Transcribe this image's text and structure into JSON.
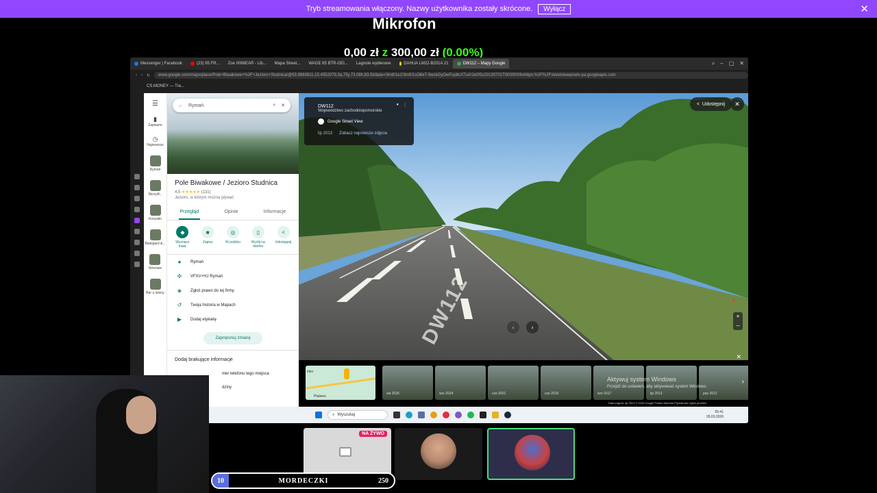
{
  "stream_banner": {
    "text": "Tryb streamowania włączony. Nazwy użytkownika zostały skrócone.",
    "button": "Wyłącz",
    "close": "✕"
  },
  "goal": {
    "title": "Mikrofon",
    "current": "0,00 zł",
    "separator": "z",
    "target": "300,00 zł",
    "percent": "(0.00%)",
    "progress_fraction": 0.0
  },
  "browser": {
    "tabs": [
      "Messenger | Facebook",
      "(23) 95 FR...",
      "Zoe 0086EAR - Lib...",
      "Mapa Street...",
      "WAGE 85 BTR-GEI...",
      "Lagnote wyblerane",
      "DAHUA LM22-B201A 21",
      "DW112 – Mapy Google"
    ],
    "url": "www.google.com/maps/place/Pole+Biwakowe+%2F+Jezioro+Studnica/@53.9960811,15.4552079,3a,75y,73.08h,83.5t/data=!3m8!1e1!3m6!1sO6eT-9wckGyOwFup8cXTuA!2e0!5s20130701T000000!6shttps:%2F%2Fstreetviewpixels-pa.googleapis.com",
    "bookmark": "CS.MONEY — Tra..."
  },
  "maps": {
    "search_value": "Rymań",
    "nav": [
      {
        "label": "Zapisano"
      },
      {
        "label": "Najnowsze"
      },
      {
        "label": "Rymań"
      },
      {
        "label": "Skrzydł..."
      },
      {
        "label": "Koszalin"
      },
      {
        "label": "Białogard &..."
      },
      {
        "label": "Wrocław"
      },
      {
        "label": "Bar u Iwony"
      }
    ],
    "place": {
      "title": "Pole Biwakowe / Jezioro Studnica",
      "rating": "4,5",
      "stars": "★★★★★",
      "reviews": "(131)",
      "subtitle": "Jezioro, w którym można pływać",
      "tabs": [
        "Przegląd",
        "Opinie",
        "Informacje"
      ],
      "actions": [
        {
          "icon": "◆",
          "label": "Wyznacz trasę"
        },
        {
          "icon": "■",
          "label": "Zapisz"
        },
        {
          "icon": "◎",
          "label": "W pobliżu"
        },
        {
          "icon": "▯",
          "label": "Wyślij na telefon"
        },
        {
          "icon": "<",
          "label": "Udostępnij"
        }
      ],
      "info": [
        {
          "icon": "●",
          "text": "Rymań"
        },
        {
          "icon": "✣",
          "text": "VFXV+HJ Rymań"
        },
        {
          "icon": "◈",
          "text": "Zgłoś prawo do tej firmy"
        },
        {
          "icon": "↺",
          "text": "Twoja historia w Mapach"
        },
        {
          "icon": "▶",
          "text": "Dodaj etykietę"
        }
      ],
      "suggest": "Zaproponuj zmianę",
      "missing_title": "Dodaj brakujące informacje",
      "missing_items": [
        "mer telefonu tego miejsca",
        "dziny"
      ]
    },
    "street_view": {
      "road": "DW112",
      "region": "Województwo zachodniopomorskie",
      "gsv_label": "Google Street View",
      "date": "lip 2013",
      "newer_link": "Zobacz najnowsze zdjęcia",
      "share": "Udostępnij",
      "road_marking": "DW112"
    },
    "filmstrip": {
      "minimap_label": "inko",
      "minimap_sub": "Ptalewo",
      "frames": [
        "sie 2025",
        "wrz 2024",
        "cze 2021",
        "cze 2019",
        "wrz 2017",
        "lip 2013",
        "paz 2012"
      ],
      "activate_title": "Aktywuj system Windows",
      "activate_sub": "Przejdź do ustawień, aby aktywować system Windows.",
      "footer": "Data zdjęcia: lip 2013   © 2026 Google   Polska   Warunki   Prywatność   Zgłoś problem"
    }
  },
  "taskbar": {
    "search_placeholder": "Wyszukaj",
    "time": "05:41",
    "date": "05.03.2026"
  },
  "participants": {
    "live_badge": "NA ŻYWO"
  },
  "counter": {
    "current": "10",
    "label": "MORDECZKI",
    "max": "250"
  }
}
